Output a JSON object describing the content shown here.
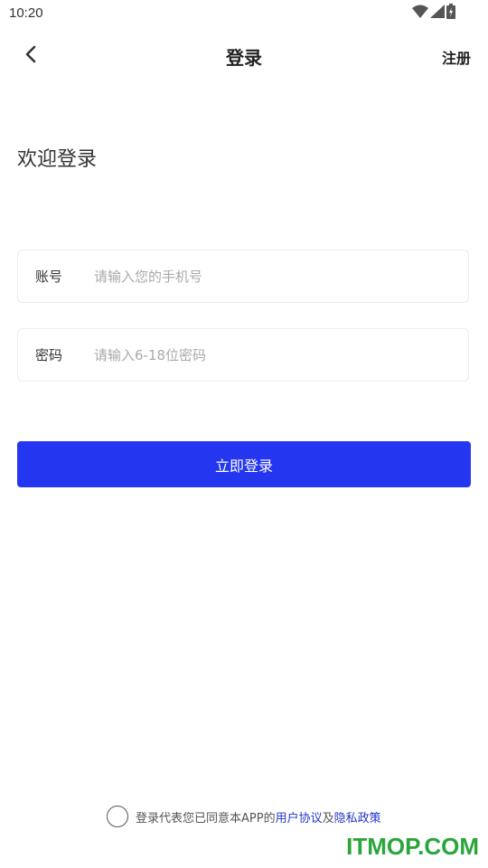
{
  "status_bar": {
    "time": "10:20",
    "icons": [
      "wifi-icon",
      "signal-icon",
      "battery-icon"
    ]
  },
  "header": {
    "back_icon": "chevron-left-icon",
    "title": "登录",
    "register_label": "注册"
  },
  "welcome_text": "欢迎登录",
  "form": {
    "account": {
      "label": "账号",
      "value": "",
      "placeholder": "请输入您的手机号"
    },
    "password": {
      "label": "密码",
      "value": "",
      "placeholder": "请输入6-18位密码"
    },
    "submit_label": "立即登录"
  },
  "agreement": {
    "checked": false,
    "prefix": "登录代表您已同意本APP的",
    "user_agreement": "用户协议",
    "conjunction": "及",
    "privacy_policy": "隐私政策"
  },
  "watermark": "ITMOP.COM",
  "colors": {
    "primary": "#2436f0",
    "link": "#2436c8",
    "watermark": "#2aa53a"
  }
}
